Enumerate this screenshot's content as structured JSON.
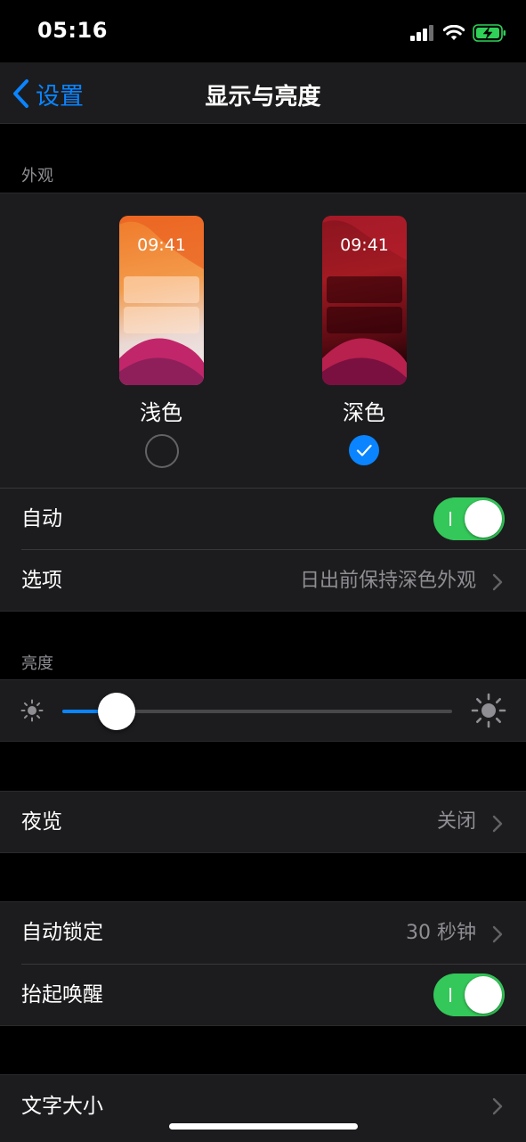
{
  "status_bar": {
    "time": "05:16"
  },
  "nav": {
    "back_label": "设置",
    "title": "显示与亮度"
  },
  "appearance": {
    "header": "外观",
    "light": {
      "preview_time": "09:41",
      "label": "浅色",
      "selected": false
    },
    "dark": {
      "preview_time": "09:41",
      "label": "深色",
      "selected": true
    },
    "automatic": {
      "label": "自动",
      "enabled": true
    },
    "options": {
      "label": "选项",
      "value": "日出前保持深色外观"
    }
  },
  "brightness": {
    "header": "亮度",
    "level": 0.14
  },
  "night_shift": {
    "label": "夜览",
    "value": "关闭"
  },
  "auto_lock": {
    "label": "自动锁定",
    "value": "30 秒钟"
  },
  "raise_to_wake": {
    "label": "抬起唤醒",
    "enabled": true
  },
  "text_size": {
    "label": "文字大小"
  },
  "colors": {
    "accent": "#0a84ff",
    "toggle_on": "#34c759"
  }
}
